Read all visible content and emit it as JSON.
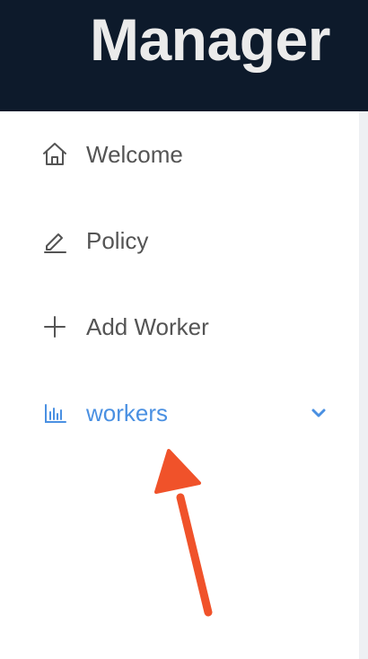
{
  "header": {
    "title": "Manager"
  },
  "sidebar": {
    "items": [
      {
        "label": "Welcome",
        "icon": "home-icon",
        "active": false
      },
      {
        "label": "Policy",
        "icon": "edit-icon",
        "active": false
      },
      {
        "label": "Add Worker",
        "icon": "plus-icon",
        "active": false
      },
      {
        "label": "workers",
        "icon": "bar-chart-icon",
        "active": true,
        "expandable": true
      }
    ]
  },
  "annotation": {
    "type": "arrow",
    "target": "workers"
  },
  "colors": {
    "header_bg": "#0d1a2b",
    "header_text": "#ebebeb",
    "menu_text": "#545454",
    "active_accent": "#4a90e2",
    "annotation_arrow": "#f0522a"
  }
}
